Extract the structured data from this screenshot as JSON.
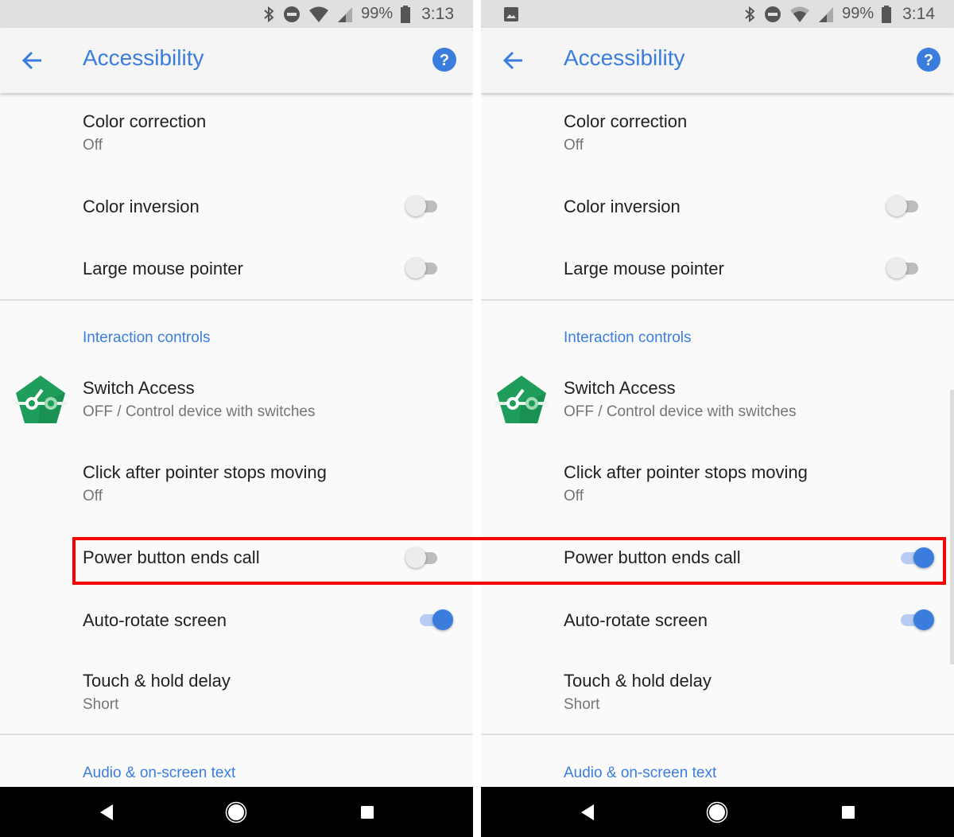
{
  "colors": {
    "accent": "#3b7ddd",
    "toggle_on_track": "#b7cdf5",
    "toggle_off_track": "#bdbdbd",
    "highlight": "#ff0000",
    "status_bar": "#e0e0e0",
    "nav_bar": "#000000"
  },
  "panels": [
    {
      "status": {
        "battery": "99%",
        "time": "3:13",
        "icons": [
          "bluetooth-icon",
          "do-not-disturb-icon",
          "wifi-icon",
          "cell-signal-icon",
          "battery-icon"
        ]
      },
      "appbar": {
        "title": "Accessibility",
        "back_icon": "arrow-back-icon",
        "help_icon": "help-icon"
      },
      "items": {
        "color_correction": {
          "title": "Color correction",
          "summary": "Off"
        },
        "color_inversion": {
          "title": "Color inversion",
          "toggle": "off"
        },
        "large_pointer": {
          "title": "Large mouse pointer",
          "toggle": "off"
        },
        "section_interaction": "Interaction controls",
        "switch_access": {
          "title": "Switch Access",
          "summary": "OFF / Control device with switches"
        },
        "click_after": {
          "title": "Click after pointer stops moving",
          "summary": "Off"
        },
        "power_ends_call": {
          "title": "Power button ends call",
          "toggle": "off"
        },
        "auto_rotate": {
          "title": "Auto-rotate screen",
          "toggle": "on"
        },
        "touch_hold": {
          "title": "Touch & hold delay",
          "summary": "Short"
        },
        "section_audio": "Audio & on-screen text"
      }
    },
    {
      "status": {
        "notification_icon": "image-icon",
        "battery": "99%",
        "time": "3:14",
        "icons": [
          "bluetooth-icon",
          "do-not-disturb-icon",
          "wifi-icon",
          "cell-signal-icon",
          "battery-icon"
        ]
      },
      "appbar": {
        "title": "Accessibility",
        "back_icon": "arrow-back-icon",
        "help_icon": "help-icon"
      },
      "items": {
        "color_correction": {
          "title": "Color correction",
          "summary": "Off"
        },
        "color_inversion": {
          "title": "Color inversion",
          "toggle": "off"
        },
        "large_pointer": {
          "title": "Large mouse pointer",
          "toggle": "off"
        },
        "section_interaction": "Interaction controls",
        "switch_access": {
          "title": "Switch Access",
          "summary": "OFF / Control device with switches"
        },
        "click_after": {
          "title": "Click after pointer stops moving",
          "summary": "Off"
        },
        "power_ends_call": {
          "title": "Power button ends call",
          "toggle": "on"
        },
        "auto_rotate": {
          "title": "Auto-rotate screen",
          "toggle": "on"
        },
        "touch_hold": {
          "title": "Touch & hold delay",
          "summary": "Short"
        },
        "section_audio": "Audio & on-screen text"
      }
    }
  ],
  "navbar": {
    "buttons": [
      "back-icon",
      "home-icon",
      "recents-icon"
    ]
  },
  "annotation": {
    "highlighted_setting": "Power button ends call"
  }
}
